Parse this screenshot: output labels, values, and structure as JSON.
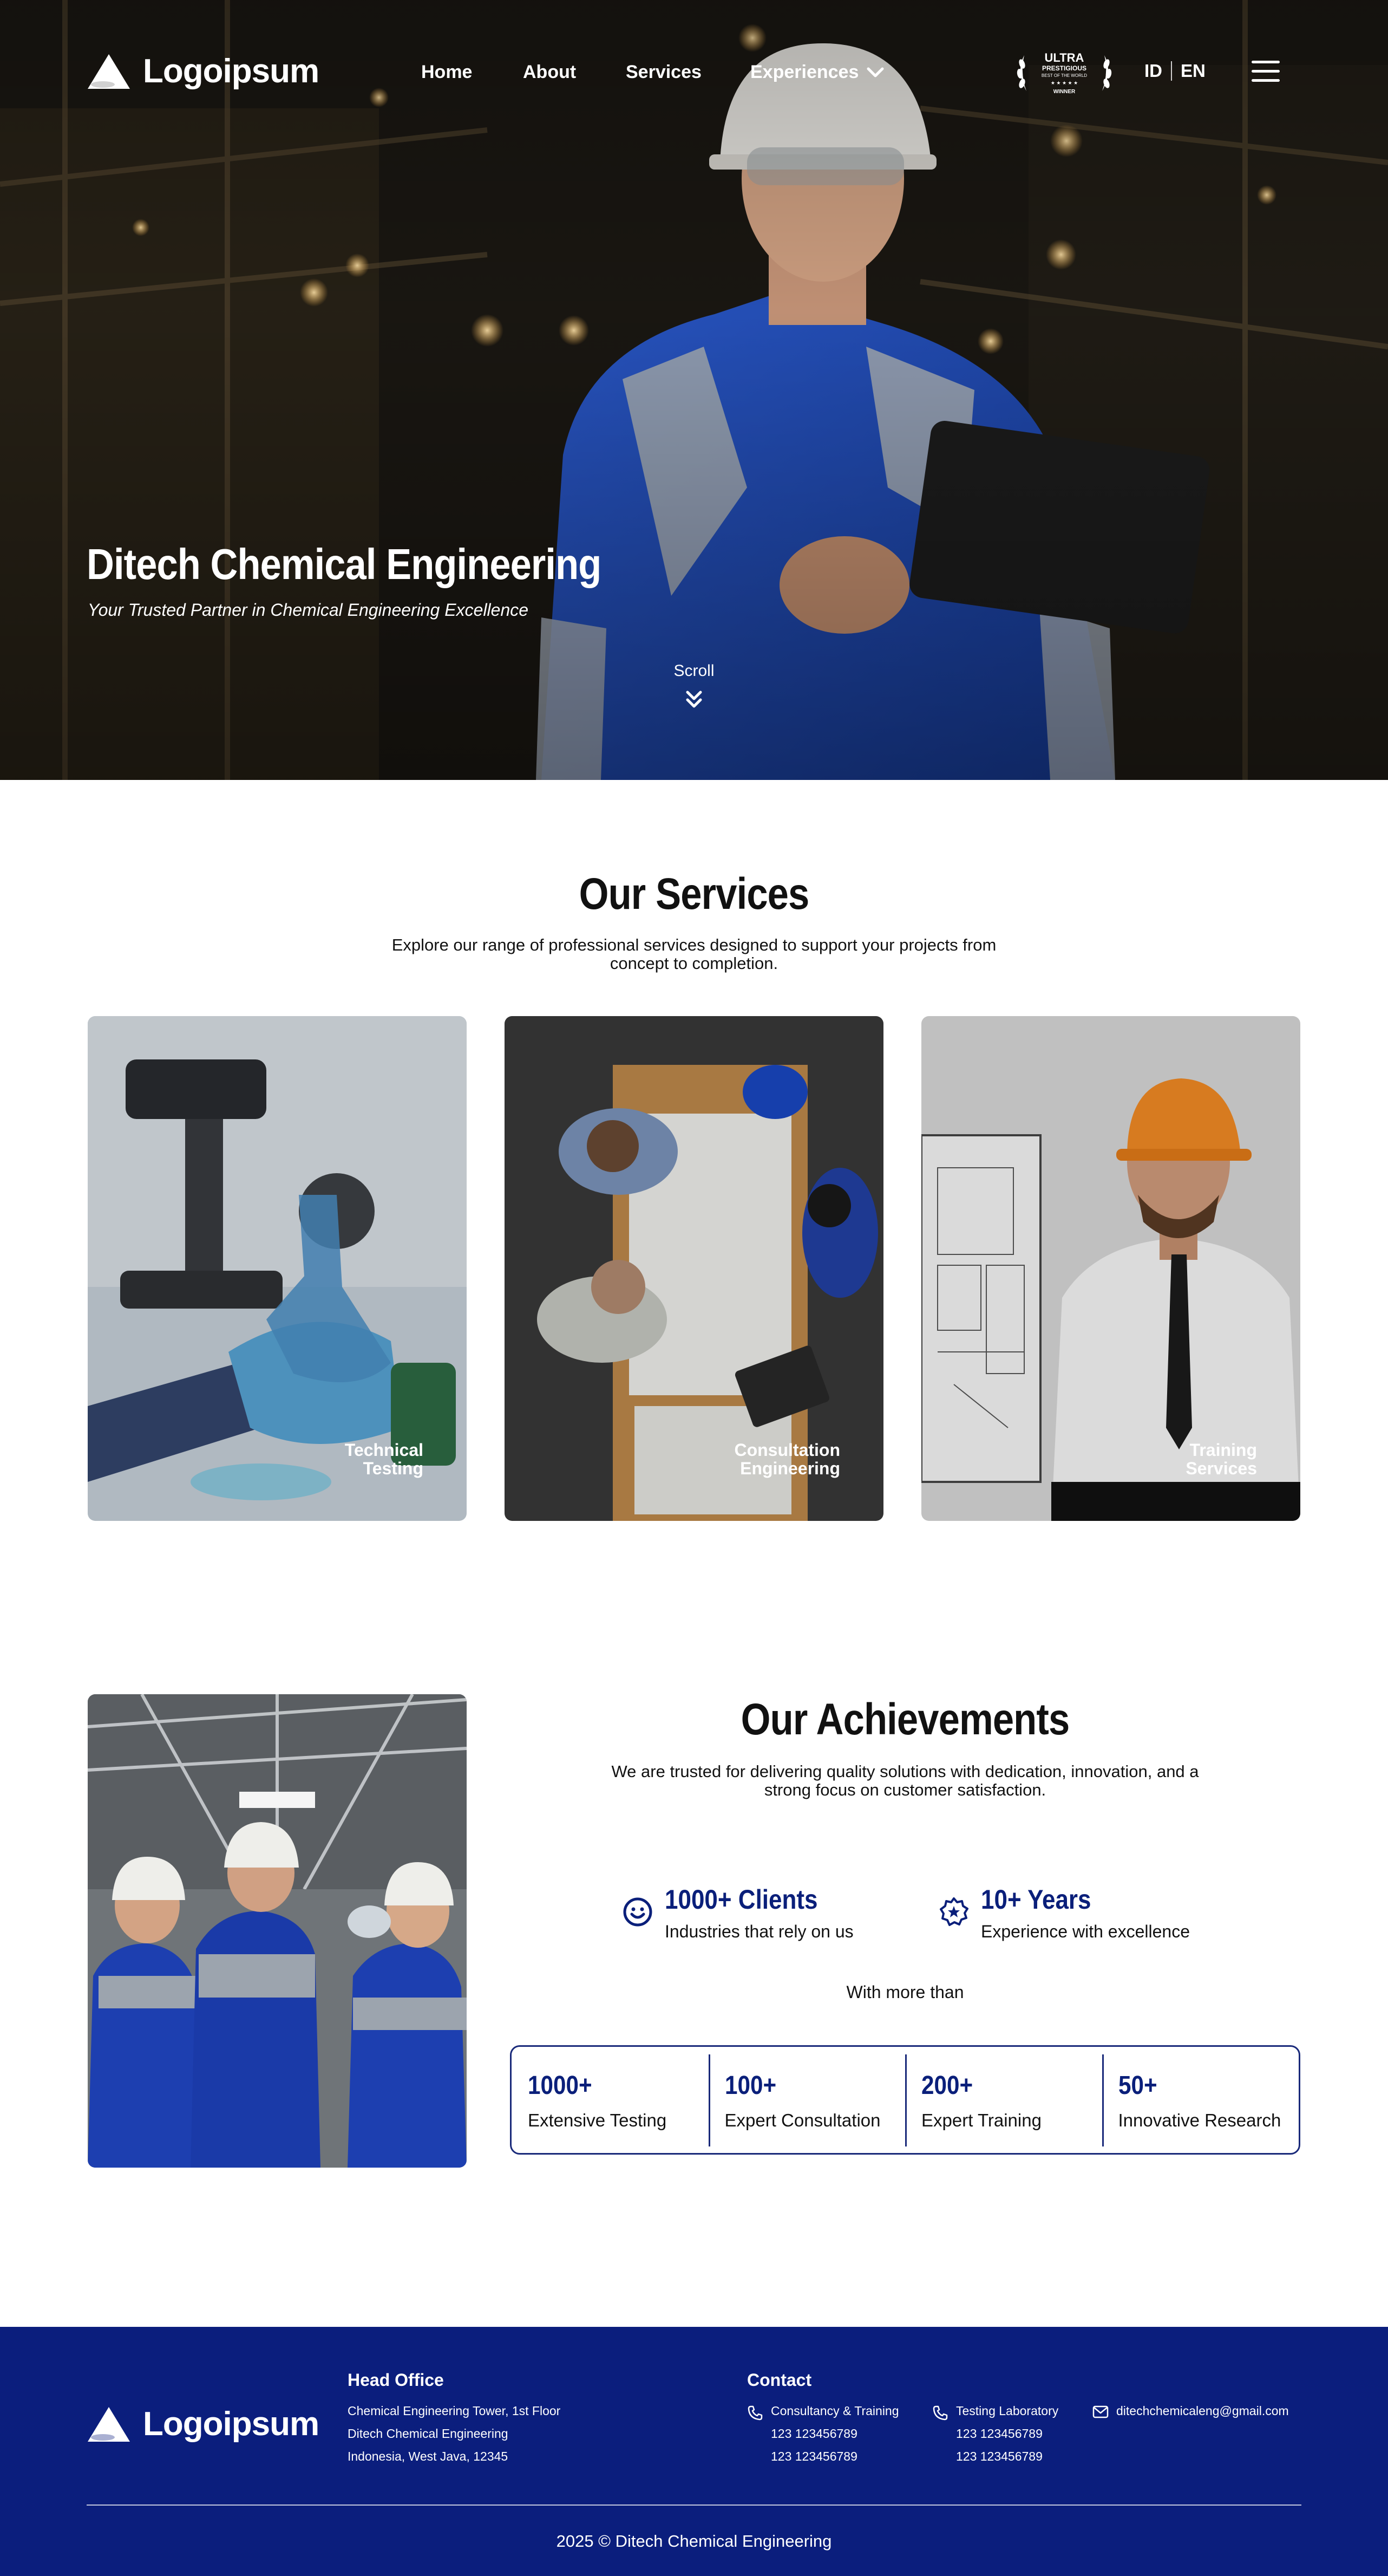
{
  "header": {
    "logo_text": "Logoipsum",
    "nav": {
      "home": "Home",
      "about": "About",
      "services": "Services",
      "experiences": "Experiences"
    },
    "badge": {
      "line1": "ULTRA",
      "line2": "PRESTIGIOUS",
      "line3": "BEST OF THE WORLD",
      "line4": "WINNER"
    },
    "lang": {
      "id": "ID",
      "en": "EN"
    }
  },
  "hero": {
    "title": "Ditech Chemical Engineering",
    "subtitle": "Your Trusted Partner in Chemical Engineering Excellence",
    "scroll_label": "Scroll"
  },
  "services": {
    "title": "Our Services",
    "description": "Explore our range of professional services designed to support your projects from concept to completion.",
    "cards": [
      {
        "label": "Technical\nTesting"
      },
      {
        "label": "Consultation\nEngineering"
      },
      {
        "label": "Training\nServices"
      }
    ]
  },
  "achievements": {
    "title": "Our Achievements",
    "description": "We are trusted for delivering quality solutions with dedication, innovation, and a strong focus on customer satisfaction.",
    "stats": [
      {
        "number": "1000+ Clients",
        "label": "Industries that rely on us",
        "icon": "smile-icon"
      },
      {
        "number": "10+ Years",
        "label": "Experience with excellence",
        "icon": "star-badge-icon"
      }
    ],
    "with_more": "With more than",
    "counters": [
      {
        "number": "1000+",
        "label": "Extensive Testing"
      },
      {
        "number": "100+",
        "label": "Expert Consultation"
      },
      {
        "number": "200+",
        "label": "Expert Training"
      },
      {
        "number": "50+",
        "label": "Innovative Research"
      }
    ]
  },
  "footer": {
    "logo_text": "Logoipsum",
    "head_office": {
      "title": "Head Office",
      "lines": [
        "Chemical Engineering Tower, 1st Floor",
        "Ditech Chemical Engineering",
        "Indonesia, West Java, 12345"
      ]
    },
    "contact": {
      "title": "Contact",
      "items": [
        {
          "icon": "phone-icon",
          "lines": [
            "Consultancy & Training",
            "123 123456789",
            "123 123456789"
          ]
        },
        {
          "icon": "phone-icon",
          "lines": [
            "Testing Laboratory",
            "123 123456789",
            "123 123456789"
          ]
        },
        {
          "icon": "mail-icon",
          "lines": [
            "ditechchemicaleng@gmail.com"
          ]
        }
      ]
    },
    "copyright": "2025 © Ditech Chemical Engineering"
  },
  "colors": {
    "brand_blue": "#0b1e7d",
    "accent_navy": "#0a1f7a",
    "text": "#111111",
    "white": "#ffffff"
  }
}
